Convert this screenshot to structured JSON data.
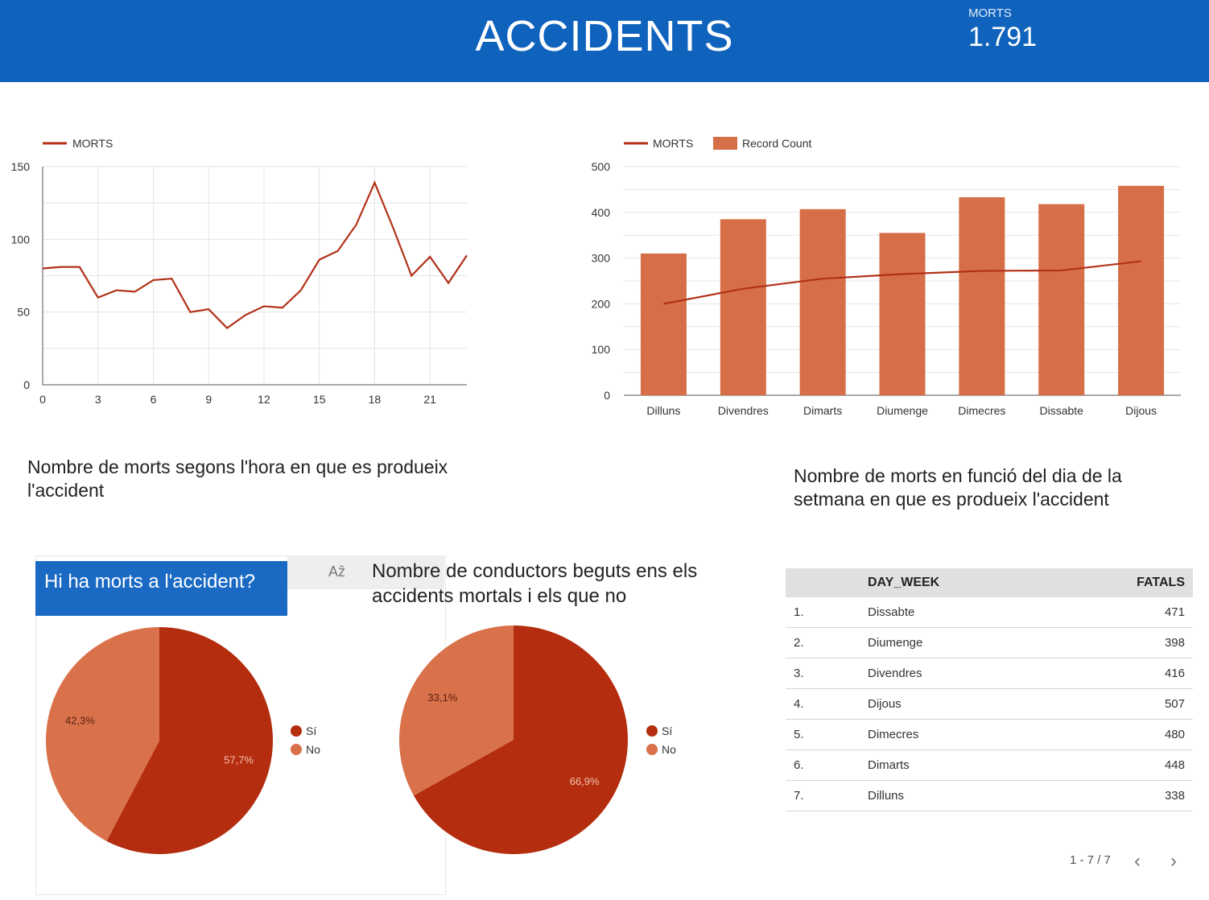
{
  "header": {
    "title": "ACCIDENTS",
    "kpi_label": "MORTS",
    "kpi_value": "1.791",
    "color": "#0f63bd"
  },
  "colors": {
    "line": "#b23118",
    "bar": "#d66f47",
    "pie_si": "#b52d0f",
    "pie_no": "#d9714a"
  },
  "captions": {
    "hour_chart": "Nombre de morts segons l'hora en que es produeix l'accident",
    "day_chart": "Nombre de morts en funció del dia de la setmana en que es produeix l'accident",
    "drivers_chart": "Nombre de conductors beguts ens els accidents mortals i els que no"
  },
  "control": {
    "label": "Hi ha morts a l'accident?",
    "sort_icon": "sort-az-icon"
  },
  "chart_data": [
    {
      "type": "line",
      "legend": [
        "MORTS"
      ],
      "x": [
        0,
        1,
        2,
        3,
        4,
        5,
        6,
        7,
        8,
        9,
        10,
        11,
        12,
        13,
        14,
        15,
        16,
        17,
        18,
        19,
        20,
        21,
        22,
        23
      ],
      "series": [
        {
          "name": "MORTS",
          "values": [
            80,
            81,
            81,
            60,
            65,
            64,
            72,
            73,
            50,
            52,
            39,
            48,
            54,
            53,
            65,
            86,
            92,
            110,
            139,
            108,
            75,
            88,
            70,
            89
          ]
        }
      ],
      "ylim": [
        0,
        150
      ],
      "yticks": [
        0,
        50,
        100,
        150
      ],
      "xticks": [
        0,
        3,
        6,
        9,
        12,
        15,
        18,
        21
      ],
      "grid": true,
      "legend_position": "top-left"
    },
    {
      "type": "bar",
      "legend": [
        "MORTS",
        "Record Count"
      ],
      "categories": [
        "Dilluns",
        "Divendres",
        "Dimarts",
        "Diumenge",
        "Dimecres",
        "Dissabte",
        "Dijous"
      ],
      "series": [
        {
          "name": "Record Count",
          "values": [
            310,
            385,
            407,
            355,
            433,
            418,
            458
          ]
        },
        {
          "name": "MORTS",
          "values": [
            200,
            233,
            255,
            265,
            272,
            273,
            293
          ]
        }
      ],
      "ylim": [
        0,
        500
      ],
      "yticks": [
        0,
        100,
        200,
        300,
        400,
        500
      ],
      "grid": true,
      "legend_position": "top-left"
    },
    {
      "type": "pie",
      "labels": [
        "Sí",
        "No"
      ],
      "values": [
        57.7,
        42.3
      ],
      "value_labels": [
        "57,7%",
        "42,3%"
      ]
    },
    {
      "type": "pie",
      "labels": [
        "Sí",
        "No"
      ],
      "values": [
        66.9,
        33.1
      ],
      "value_labels": [
        "66,9%",
        "33,1%"
      ]
    },
    {
      "type": "table",
      "columns": [
        "DAY_WEEK",
        "FATALS"
      ],
      "rows": [
        [
          "1.",
          "Dissabte",
          "471"
        ],
        [
          "2.",
          "Diumenge",
          "398"
        ],
        [
          "3.",
          "Divendres",
          "416"
        ],
        [
          "4.",
          "Dijous",
          "507"
        ],
        [
          "5.",
          "Dimecres",
          "480"
        ],
        [
          "6.",
          "Dimarts",
          "448"
        ],
        [
          "7.",
          "Dilluns",
          "338"
        ]
      ]
    }
  ],
  "pagination": {
    "label": "1 - 7 / 7",
    "prev_icon": "chevron-left-icon",
    "next_icon": "chevron-right-icon"
  }
}
